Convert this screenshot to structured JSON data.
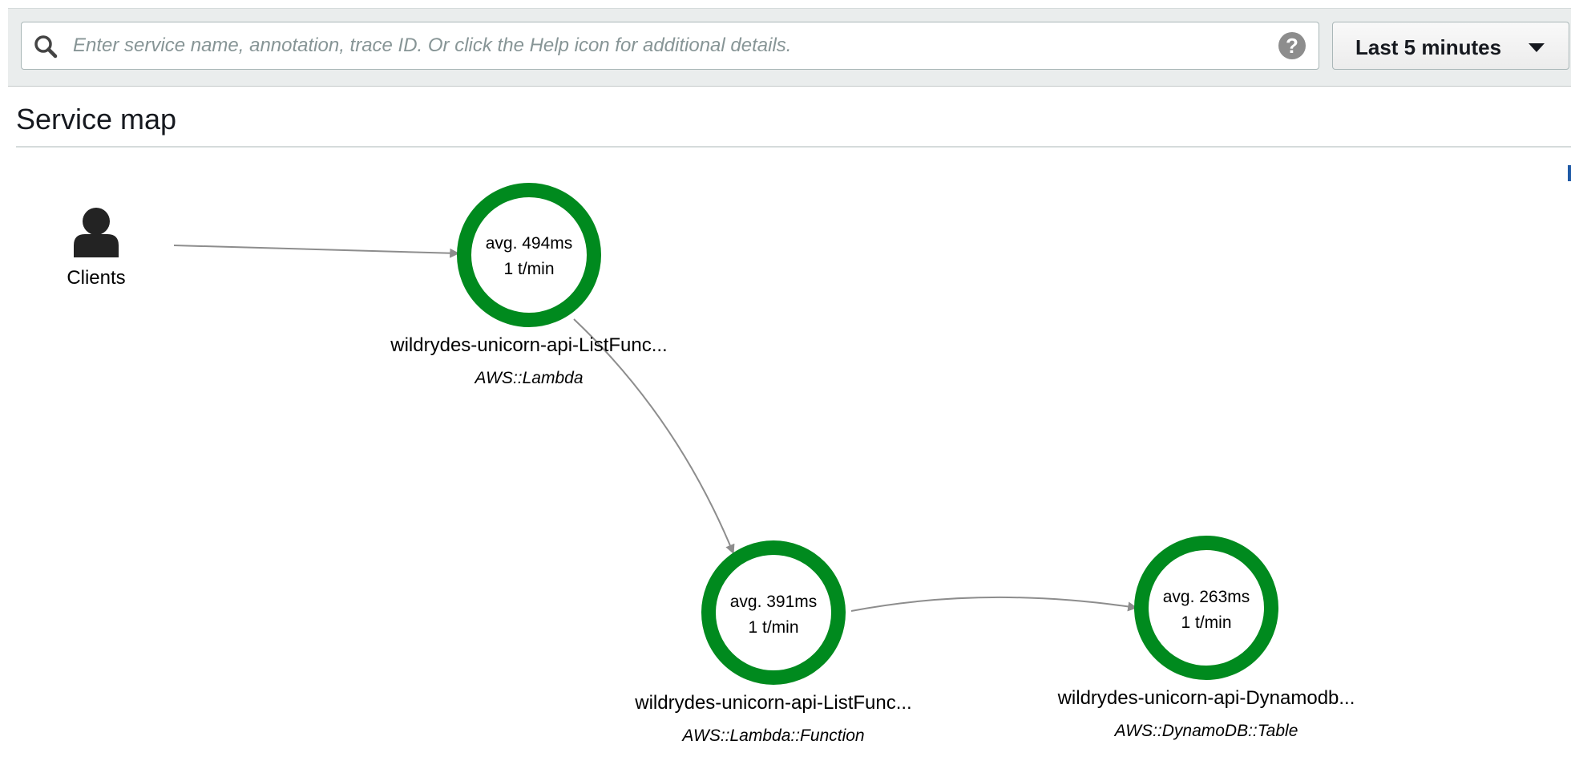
{
  "search": {
    "placeholder": "Enter service name, annotation, trace ID. Or click the Help icon for additional details.",
    "help_glyph": "?"
  },
  "time_range": {
    "selected": "Last 5 minutes"
  },
  "page": {
    "title": "Service map"
  },
  "colors": {
    "node_ok": "#008a1e",
    "edge": "#8d8d8d",
    "client_icon": "#232323"
  },
  "clients": {
    "label": "Clients",
    "icon": "user-icon"
  },
  "nodes": [
    {
      "id": "lambda",
      "avg": "avg. 494ms",
      "rate": "1 t/min",
      "name": "wildrydes-unicorn-api-ListFunc...",
      "type": "AWS::Lambda",
      "health": "ok"
    },
    {
      "id": "lambda-function",
      "avg": "avg. 391ms",
      "rate": "1 t/min",
      "name": "wildrydes-unicorn-api-ListFunc...",
      "type": "AWS::Lambda::Function",
      "health": "ok"
    },
    {
      "id": "dynamodb-table",
      "avg": "avg. 263ms",
      "rate": "1 t/min",
      "name": "wildrydes-unicorn-api-Dynamodb...",
      "type": "AWS::DynamoDB::Table",
      "health": "ok"
    }
  ],
  "edges": [
    {
      "from": "clients",
      "to": "lambda"
    },
    {
      "from": "lambda",
      "to": "lambda-function"
    },
    {
      "from": "lambda-function",
      "to": "dynamodb-table"
    }
  ]
}
